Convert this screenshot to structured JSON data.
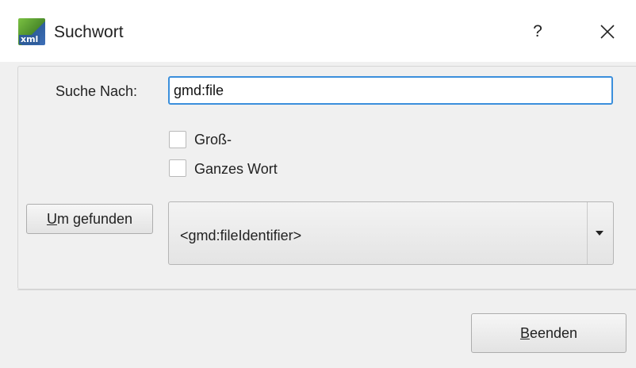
{
  "window": {
    "title": "Suchwort",
    "icon_label": "xml",
    "help_label": "?",
    "close_icon": "close-icon"
  },
  "search": {
    "label": "Suche Nach:",
    "value": "gmd:file"
  },
  "options": {
    "case_label": "Groß-",
    "case_checked": false,
    "whole_word_label": "Ganzes Wort",
    "whole_word_checked": false
  },
  "actions": {
    "find_mnemonic": "U",
    "find_rest": "m gefunden",
    "close_mnemonic": "B",
    "close_rest": "eenden"
  },
  "results": {
    "selected": "<gmd:fileIdentifier>",
    "arrow_icon": "dropdown-arrow-icon"
  },
  "colors": {
    "focus_border": "#3b8fdc",
    "dialog_bg": "#f0f0f0"
  }
}
